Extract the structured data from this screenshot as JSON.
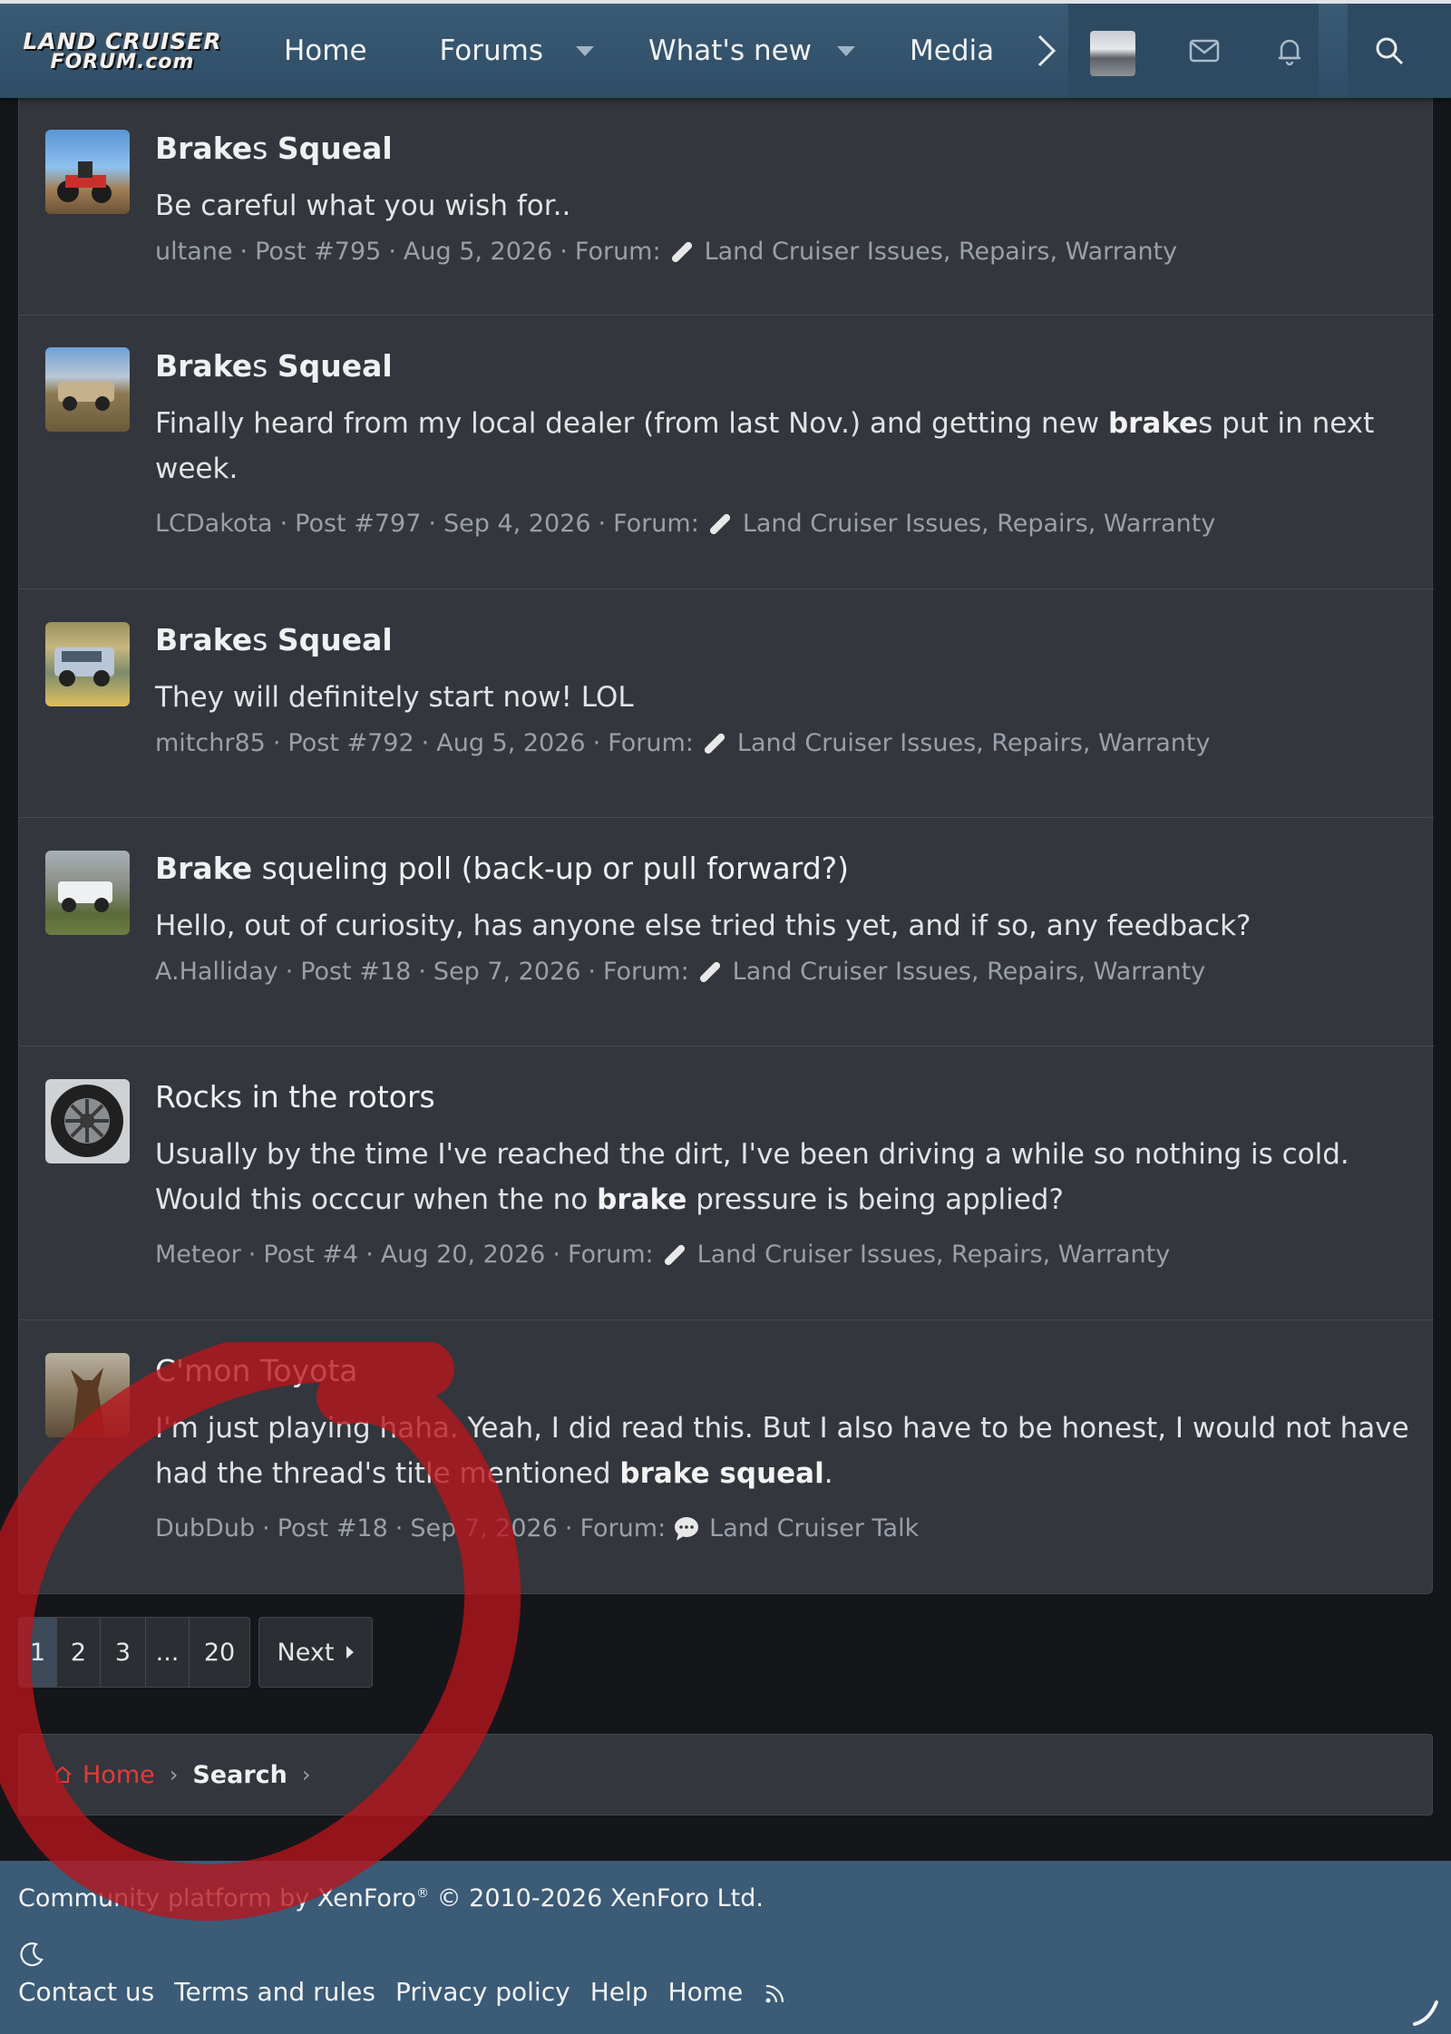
{
  "nav": {
    "logo_line1": "LAND CRUISER",
    "logo_line2": "FORUM.com",
    "items": [
      {
        "label": "Home"
      },
      {
        "label": "Forums"
      },
      {
        "label": "What's new"
      },
      {
        "label": "Media"
      }
    ]
  },
  "results": [
    {
      "title_bold1": "Brake",
      "title_normal1": "s ",
      "title_bold2": "Squeal",
      "title_normal2": "",
      "snippet": [
        "Be careful what you wish for.."
      ],
      "author": "ultane",
      "post": "Post #795",
      "date": "Aug 5, 2026",
      "forum_label": "Forum:",
      "forum": "Land Cruiser Issues, Repairs, Warranty"
    },
    {
      "title_bold1": "Brake",
      "title_normal1": "s ",
      "title_bold2": "Squeal",
      "title_normal2": "",
      "snippet_a": "Finally heard from my local dealer (from last Nov.) and getting new ",
      "snippet_b": "brake",
      "snippet_c": "s put in next week.",
      "author": "LCDakota",
      "post": "Post #797",
      "date": "Sep 4, 2026",
      "forum_label": "Forum:",
      "forum": "Land Cruiser Issues, Repairs, Warranty"
    },
    {
      "title_bold1": "Brake",
      "title_normal1": "s ",
      "title_bold2": "Squeal",
      "title_normal2": "",
      "snippet": [
        "They will definitely start now! LOL"
      ],
      "author": "mitchr85",
      "post": "Post #792",
      "date": "Aug 5, 2026",
      "forum_label": "Forum:",
      "forum": "Land Cruiser Issues, Repairs, Warranty"
    },
    {
      "title_bold1": "Brake",
      "title_normal1": " squeling poll (back-up or pull forward?)",
      "snippet": [
        "Hello, out of curiosity, has anyone else tried this yet, and if so, any feedback?"
      ],
      "author": "A.Halliday",
      "post": "Post #18",
      "date": "Sep 7, 2026",
      "forum_label": "Forum:",
      "forum": "Land Cruiser Issues, Repairs, Warranty"
    },
    {
      "title": "Rocks in the rotors",
      "snippet_a": "Usually by the time I've reached the dirt, I've been driving a while so nothing is cold. Would this occcur when the no ",
      "snippet_b": "brake",
      "snippet_c": " pressure is being applied?",
      "author": "Meteor",
      "post": "Post #4",
      "date": "Aug 20, 2026",
      "forum_label": "Forum:",
      "forum": "Land Cruiser Issues, Repairs, Warranty"
    },
    {
      "title": "C'mon Toyota",
      "snippet_a": "I'm just playing haha. Yeah, I did read this. But I also have to be honest, I would not have had the thread's title mentioned ",
      "snippet_b": "brake squeal",
      "snippet_c": ".",
      "author": "DubDub",
      "post": "Post #18",
      "date": "Sep 7, 2026",
      "forum_label": "Forum:",
      "forum": "Land Cruiser Talk"
    }
  ],
  "pagination": {
    "pages": [
      "1",
      "2",
      "3",
      "...",
      "20"
    ],
    "current": "1",
    "next_label": "Next"
  },
  "breadcrumb": {
    "home": "Home",
    "search": "Search"
  },
  "footer": {
    "copyright": "Community platform by XenForo",
    "reg": "®",
    "copyright_tail": " © 2010-2026 XenForo Ltd.",
    "links": [
      "Contact us",
      "Terms and rules",
      "Privacy policy",
      "Help",
      "Home"
    ]
  },
  "colors": {
    "nav_bg": "#3a5a74",
    "panel_bg": "#33363c",
    "page_bg": "#14161a",
    "accent_red": "#e23a3a"
  },
  "icons": [
    "bandage-icon",
    "speech-bubble-icon",
    "envelope-icon",
    "bell-icon",
    "search-icon",
    "rss-icon",
    "moon-icon",
    "chevron-right-icon",
    "home-icon"
  ]
}
